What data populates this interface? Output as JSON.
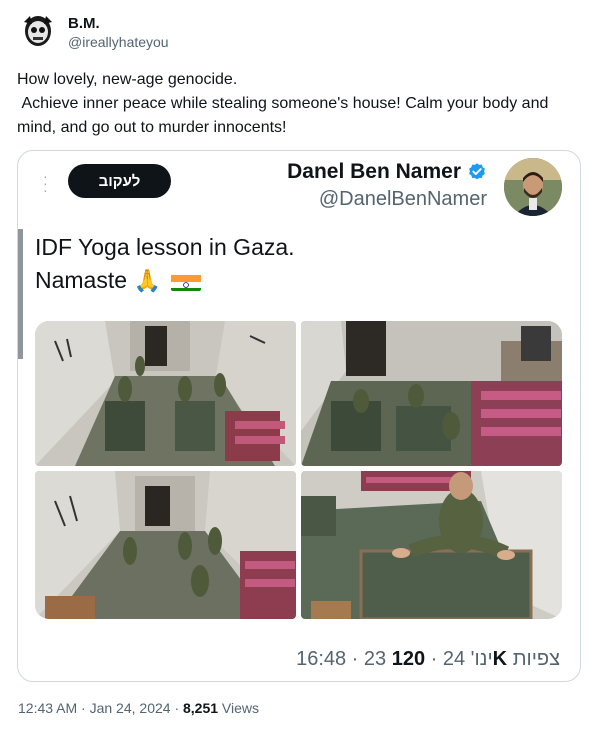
{
  "post": {
    "author_name": "B.M.",
    "author_handle": "@ireallyhateyou",
    "text": "How lovely, new-age genocide.\n Achieve inner peace while stealing someone's house! Calm your body and mind, and go out to murder innocents!",
    "timestamp": "12:43 AM · Jan 24, 2024 · ",
    "views_count": "8,251",
    "views_label": " Views"
  },
  "quote": {
    "follow_label": "לעקוב",
    "author_name": "Danel Ben Namer",
    "author_handle": "@DanelBenNamer",
    "text_line1": "IDF Yoga lesson in Gaza.",
    "text_line2": "Namaste",
    "emoji_pray": "🙏",
    "meta_time": "16:48 · 23 ינו' 24 · ",
    "meta_views": "120K",
    "meta_views_label": " צפיות"
  },
  "icons": {
    "verified": "verified-badge-icon",
    "more": "more-dots-icon",
    "flag": "india-flag-icon"
  },
  "colors": {
    "accent": "#1d9bf0",
    "follow_bg": "#0f1419",
    "secondary_text": "#536471"
  }
}
